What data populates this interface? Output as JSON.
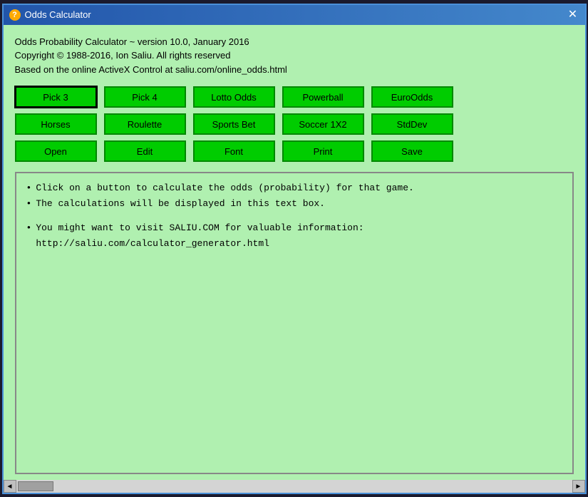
{
  "window": {
    "title": "Odds Calculator",
    "close_label": "✕"
  },
  "header": {
    "line1": "Odds Probability Calculator ~ version 10.0, January 2016",
    "line2": "Copyright © 1988-2016, Ion Saliu. All rights reserved",
    "line3": "Based on the online ActiveX Control at saliu.com/online_odds.html"
  },
  "buttons": {
    "row1": [
      {
        "label": "Pick 3",
        "name": "pick3-button",
        "active": true
      },
      {
        "label": "Pick 4",
        "name": "pick4-button",
        "active": false
      },
      {
        "label": "Lotto Odds",
        "name": "lotto-odds-button",
        "active": false
      },
      {
        "label": "Powerball",
        "name": "powerball-button",
        "active": false
      },
      {
        "label": "EuroOdds",
        "name": "euroodds-button",
        "active": false
      }
    ],
    "row2": [
      {
        "label": "Horses",
        "name": "horses-button",
        "active": false
      },
      {
        "label": "Roulette",
        "name": "roulette-button",
        "active": false
      },
      {
        "label": "Sports Bet",
        "name": "sports-bet-button",
        "active": false
      },
      {
        "label": "Soccer 1X2",
        "name": "soccer-button",
        "active": false
      },
      {
        "label": "StdDev",
        "name": "stddev-button",
        "active": false
      }
    ],
    "row3": [
      {
        "label": "Open",
        "name": "open-button",
        "active": false
      },
      {
        "label": "Edit",
        "name": "edit-button",
        "active": false
      },
      {
        "label": "Font",
        "name": "font-button",
        "active": false
      },
      {
        "label": "Print",
        "name": "print-button",
        "active": false
      },
      {
        "label": "Save",
        "name": "save-button",
        "active": false
      }
    ]
  },
  "output": {
    "lines": [
      {
        "bullet": true,
        "text": "Click on a button to calculate the odds (probability) for that game."
      },
      {
        "bullet": true,
        "text": "The calculations will be displayed in this text box."
      },
      {
        "bullet": false,
        "text": ""
      },
      {
        "bullet": true,
        "text": "You might want to visit SALIU.COM for valuable information:"
      },
      {
        "bullet": false,
        "text": "http://saliu.com/calculator_generator.html"
      }
    ]
  },
  "scrollbar": {
    "left_arrow": "◄",
    "right_arrow": "►"
  }
}
